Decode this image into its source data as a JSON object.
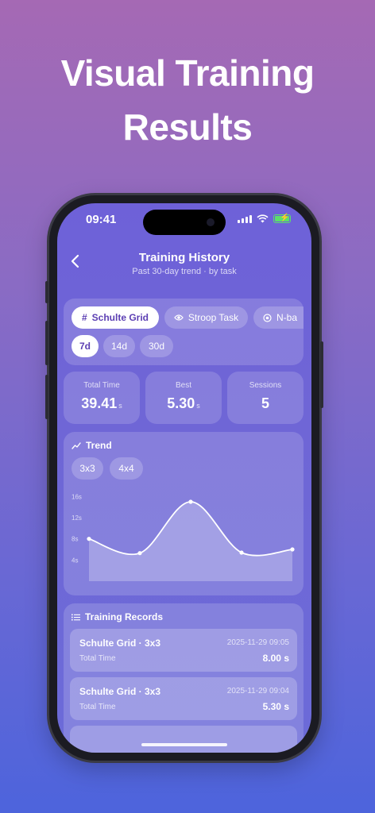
{
  "headline": {
    "line1": "Visual Training",
    "line2": "Results"
  },
  "status_bar": {
    "time": "09:41"
  },
  "nav": {
    "back_icon": "chevron-left-icon",
    "title": "Training History",
    "subtitle": "Past 30-day trend · by task"
  },
  "tasks": [
    {
      "label": "Schulte Grid",
      "icon": "#",
      "active": true
    },
    {
      "label": "Stroop Task",
      "icon": "eye-icon",
      "active": false
    },
    {
      "label": "N-ba",
      "icon": "target-icon",
      "active": false
    }
  ],
  "ranges": [
    {
      "label": "7d",
      "active": true
    },
    {
      "label": "14d",
      "active": false
    },
    {
      "label": "30d",
      "active": false
    }
  ],
  "stats": [
    {
      "label": "Total Time",
      "value": "39.41",
      "unit": "s"
    },
    {
      "label": "Best",
      "value": "5.30",
      "unit": "s"
    },
    {
      "label": "Sessions",
      "value": "5",
      "unit": ""
    }
  ],
  "trend": {
    "title": "Trend",
    "sizes": [
      {
        "label": "3x3"
      },
      {
        "label": "4x4"
      }
    ]
  },
  "chart_data": {
    "type": "area",
    "x": [
      1,
      2,
      3,
      4,
      5
    ],
    "values": [
      8.0,
      5.3,
      15.0,
      5.4,
      6.0
    ],
    "y_ticks": [
      "16s",
      "12s",
      "8s",
      "4s"
    ],
    "ylim": [
      0,
      18
    ],
    "grid": false
  },
  "records": {
    "title": "Training Records",
    "items": [
      {
        "title": "Schulte Grid · 3x3",
        "date": "2025-11-29 09:05",
        "label": "Total Time",
        "value": "8.00 s"
      },
      {
        "title": "Schulte Grid · 3x3",
        "date": "2025-11-29 09:04",
        "label": "Total Time",
        "value": "5.30 s"
      }
    ]
  },
  "colors": {
    "accent": "#5c3fb3",
    "bg_top": "#a569b4",
    "bg_bottom": "#4d64dc"
  }
}
